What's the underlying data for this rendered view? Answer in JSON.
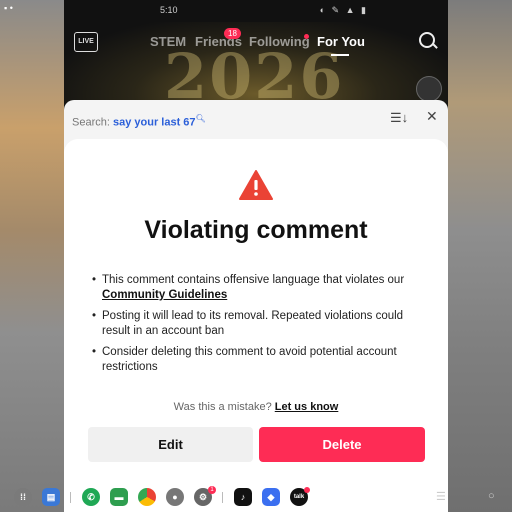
{
  "status": {
    "left": "▪ •",
    "time": "5:10",
    "icons": "◐ ✎ ▲ ▮"
  },
  "nav": {
    "live": "LIVE",
    "tabs": [
      "STEM",
      "Friends",
      "Following",
      "For You"
    ],
    "friends_badge": "18",
    "active_tab": "For You"
  },
  "video": {
    "overlay_text": "2026"
  },
  "comments_header": {
    "search_prefix": "Search:",
    "search_query": "say your last 67",
    "sort_icon": "sort-icon",
    "close_icon": "close-icon"
  },
  "modal": {
    "title": "Violating comment",
    "bullet1_text": "This comment contains offensive language that violates our",
    "bullet1_link": "Community Guidelines",
    "bullet2": "Posting it will lead to its removal. Repeated violations could result in an account ban",
    "bullet3": "Consider deleting this comment to avoid potential account restrictions",
    "mistake_text": "Was this a mistake?",
    "mistake_link": "Let us know",
    "edit_label": "Edit",
    "delete_label": "Delete",
    "warn_color": "#ea4335",
    "accent_color": "#fe2c55"
  },
  "taskbar": {
    "apps": [
      "app-drawer",
      "files",
      "phone",
      "messages",
      "chrome",
      "camera",
      "settings",
      "tiktok",
      "roblox",
      "kakao"
    ],
    "settings_badge": "1",
    "kakao_label": "talk"
  }
}
